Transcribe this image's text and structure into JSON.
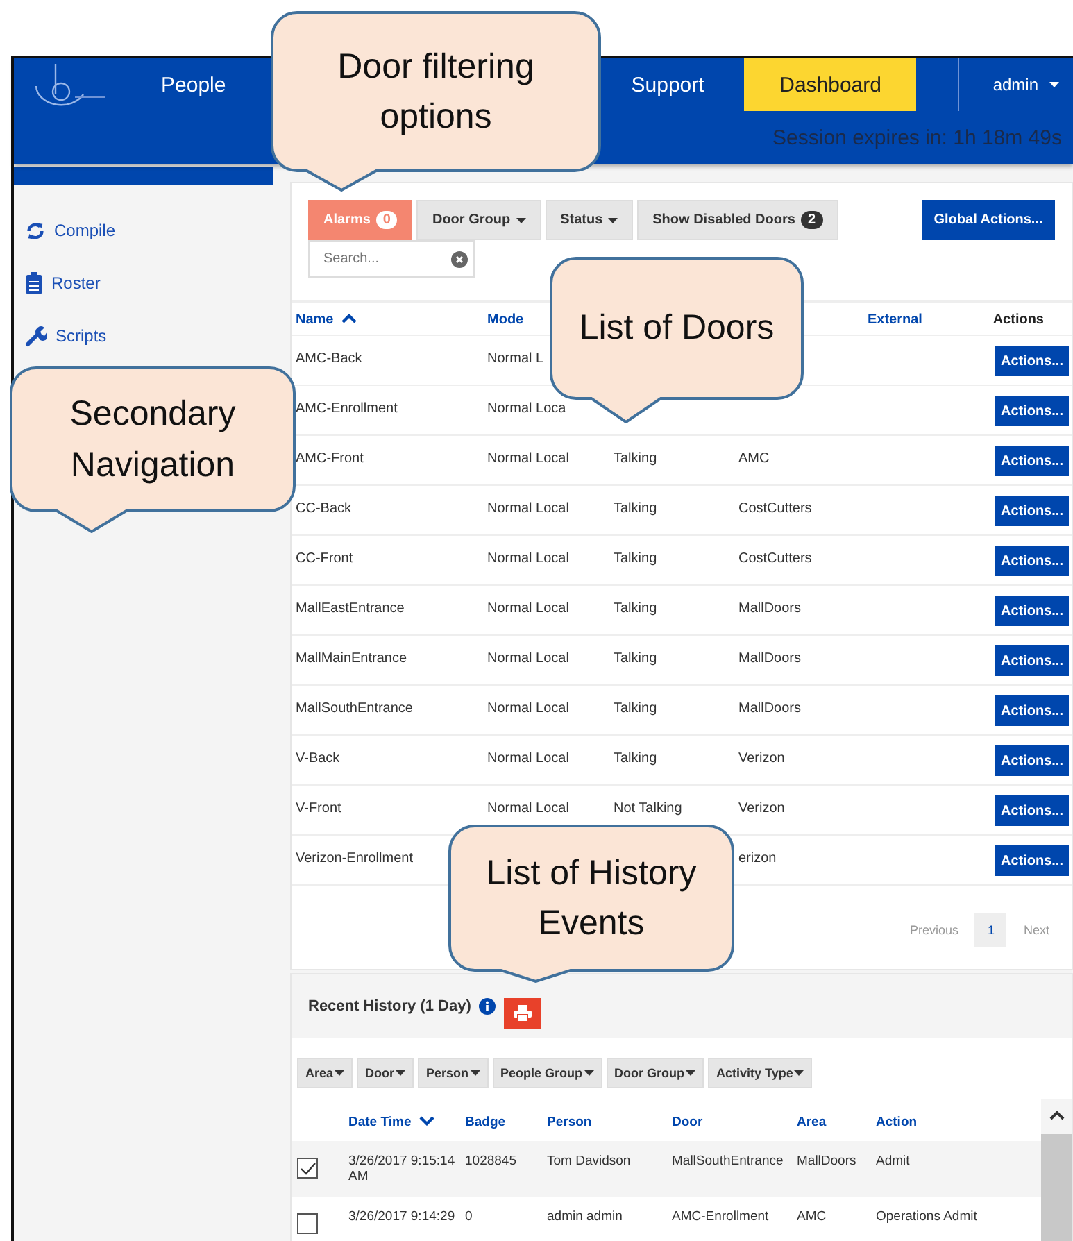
{
  "header": {
    "nav": [
      {
        "label": "People",
        "selected": false
      },
      {
        "label": "Support",
        "selected": false
      },
      {
        "label": "Dashboard",
        "selected": true
      }
    ],
    "user": "admin",
    "session": "Session expires in: 1h 18m 49s"
  },
  "sidebar": {
    "items": [
      {
        "label": "Compile"
      },
      {
        "label": "Roster"
      },
      {
        "label": "Scripts"
      }
    ]
  },
  "doors": {
    "filters": [
      {
        "kind": "alarm",
        "label": "Alarms",
        "count": "0"
      },
      {
        "kind": "dropdown",
        "label": "Door Group"
      },
      {
        "kind": "dropdown",
        "label": "Status"
      },
      {
        "kind": "toggle",
        "label": "Show Disabled Doors",
        "count": "2"
      }
    ],
    "global_action": "Global Actions...",
    "search": {
      "placeholder": "Search..."
    },
    "columns": [
      {
        "label": "Name",
        "sorted": true
      },
      {
        "label": "Mode",
        "sorted": false
      },
      {
        "label": "External",
        "sorted": false
      },
      {
        "label": "Actions",
        "sorted": false
      }
    ],
    "rows": [
      {
        "name": "AMC-Back",
        "mode": "Normal L",
        "action": "Actions..."
      },
      {
        "name": "AMC-Enrollment",
        "mode": "Normal Loca",
        "action": "Actions..."
      },
      {
        "name": "AMC-Front",
        "mode": "Normal Local",
        "status": "Talking",
        "area": "AMC",
        "action": "Actions..."
      },
      {
        "name": "CC-Back",
        "mode": "Normal Local",
        "status": "Talking",
        "area": "CostCutters",
        "action": "Actions..."
      },
      {
        "name": "CC-Front",
        "mode": "Normal Local",
        "status": "Talking",
        "area": "CostCutters",
        "action": "Actions..."
      },
      {
        "name": "MallEastEntrance",
        "mode": "Normal Local",
        "status": "Talking",
        "area": "MallDoors",
        "action": "Actions..."
      },
      {
        "name": "MallMainEntrance",
        "mode": "Normal Local",
        "status": "Talking",
        "area": "MallDoors",
        "action": "Actions..."
      },
      {
        "name": "MallSouthEntrance",
        "mode": "Normal Local",
        "status": "Talking",
        "area": "MallDoors",
        "action": "Actions..."
      },
      {
        "name": "V-Back",
        "mode": "Normal Local",
        "status": "Talking",
        "area": "Verizon",
        "action": "Actions..."
      },
      {
        "name": "V-Front",
        "mode": "Normal Local",
        "status": "Not Talking",
        "area": "Verizon",
        "action": "Actions..."
      },
      {
        "name": "Verizon-Enrollment",
        "area": "erizon",
        "action": "Actions..."
      }
    ],
    "pagination": {
      "previous": "Previous",
      "pages": [
        {
          "label": "1",
          "selected": true
        }
      ],
      "next": "Next"
    }
  },
  "history": {
    "title": "Recent History (1 Day)",
    "filters": [
      "Area",
      "Door",
      "Person",
      "People Group",
      "Door Group",
      "Activity Type"
    ],
    "columns": [
      {
        "label": "Date Time",
        "sorted": true
      },
      {
        "label": "Badge",
        "sorted": false
      },
      {
        "label": "Person",
        "sorted": false
      },
      {
        "label": "Door",
        "sorted": false
      },
      {
        "label": "Area",
        "sorted": false
      },
      {
        "label": "Action",
        "sorted": false
      }
    ],
    "rows": [
      {
        "checked": true,
        "cells": [
          "3/26/2017 9:15:14 AM",
          "1028845",
          "Tom Davidson",
          "MallSouthEntrance",
          "MallDoors",
          "Admit"
        ]
      },
      {
        "checked": false,
        "cells": [
          "3/26/2017 9:14:29",
          "0",
          "admin admin",
          "AMC-Enrollment",
          "AMC",
          "Operations Admit"
        ]
      }
    ]
  },
  "callouts": [
    {
      "text": "Door filtering options"
    },
    {
      "text": "List of Doors"
    },
    {
      "text": "Secondary Navigation"
    },
    {
      "text": "List of History Events"
    }
  ]
}
